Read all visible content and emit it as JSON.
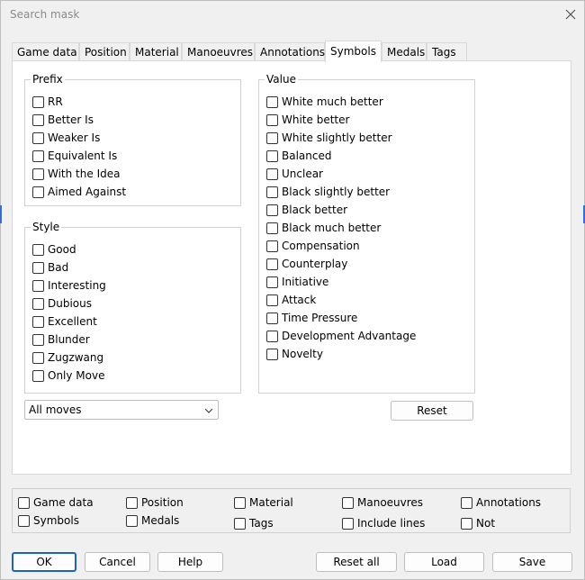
{
  "window": {
    "title": "Search mask"
  },
  "tabs": [
    {
      "label": "Game data"
    },
    {
      "label": "Position"
    },
    {
      "label": "Material"
    },
    {
      "label": "Manoeuvres"
    },
    {
      "label": "Annotations"
    },
    {
      "label": "Symbols",
      "active": true
    },
    {
      "label": "Medals"
    },
    {
      "label": "Tags"
    }
  ],
  "prefix": {
    "title": "Prefix",
    "items": [
      "RR",
      "Better Is",
      "Weaker Is",
      "Equivalent Is",
      "With the Idea",
      "Aimed Against"
    ]
  },
  "style": {
    "title": "Style",
    "items": [
      "Good",
      "Bad",
      "Interesting",
      "Dubious",
      "Excellent",
      "Blunder",
      "Zugzwang",
      "Only Move"
    ]
  },
  "value": {
    "title": "Value",
    "items": [
      "White much better",
      "White better",
      "White slightly better",
      "Balanced",
      "Unclear",
      "Black slightly better",
      "Black better",
      "Black much better",
      "Compensation",
      "Counterplay",
      "Initiative",
      "Attack",
      "Time Pressure",
      "Development Advantage",
      "Novelty"
    ]
  },
  "moves_select": {
    "value": "All moves"
  },
  "reset_button": {
    "label": "Reset"
  },
  "bottom_checks": {
    "row1": [
      "Game data",
      "Position",
      "Material",
      "Manoeuvres",
      "Annotations"
    ],
    "row2": [
      "Symbols",
      "Medals",
      "Tags",
      "Include lines",
      "Not"
    ]
  },
  "footer": {
    "ok": "OK",
    "cancel": "Cancel",
    "help": "Help",
    "reset_all": "Reset all",
    "load": "Load",
    "save": "Save"
  },
  "colors": {
    "accent": "#1a62c7",
    "border": "#d0d0d0",
    "panel": "#ffffff",
    "background": "#f0f0f0"
  }
}
